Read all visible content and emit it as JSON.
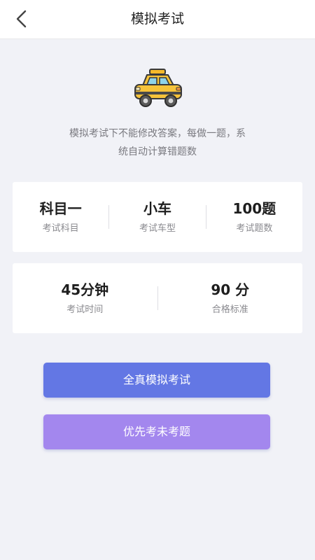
{
  "header": {
    "title": "模拟考试"
  },
  "description": {
    "line1": "模拟考试下不能修改答案，每做一题，系",
    "line2": "统自动计算错题数"
  },
  "exam_info": {
    "subject": {
      "value": "科目一",
      "label": "考试科目"
    },
    "vehicle": {
      "value": "小车",
      "label": "考试车型"
    },
    "questions": {
      "value": "100题",
      "label": "考试题数"
    },
    "duration": {
      "value": "45分钟",
      "label": "考试时间"
    },
    "pass_score": {
      "value": "90 分",
      "label": "合格标准"
    }
  },
  "actions": {
    "full_exam_label": "全真模拟考试",
    "unanswered_label": "优先考未考题"
  },
  "icons": {
    "back": "chevron-left-icon",
    "car": "taxi-car-icon"
  },
  "colors": {
    "primary": "#6377e4",
    "secondary": "#a387ee",
    "background": "#f1f2f7"
  }
}
